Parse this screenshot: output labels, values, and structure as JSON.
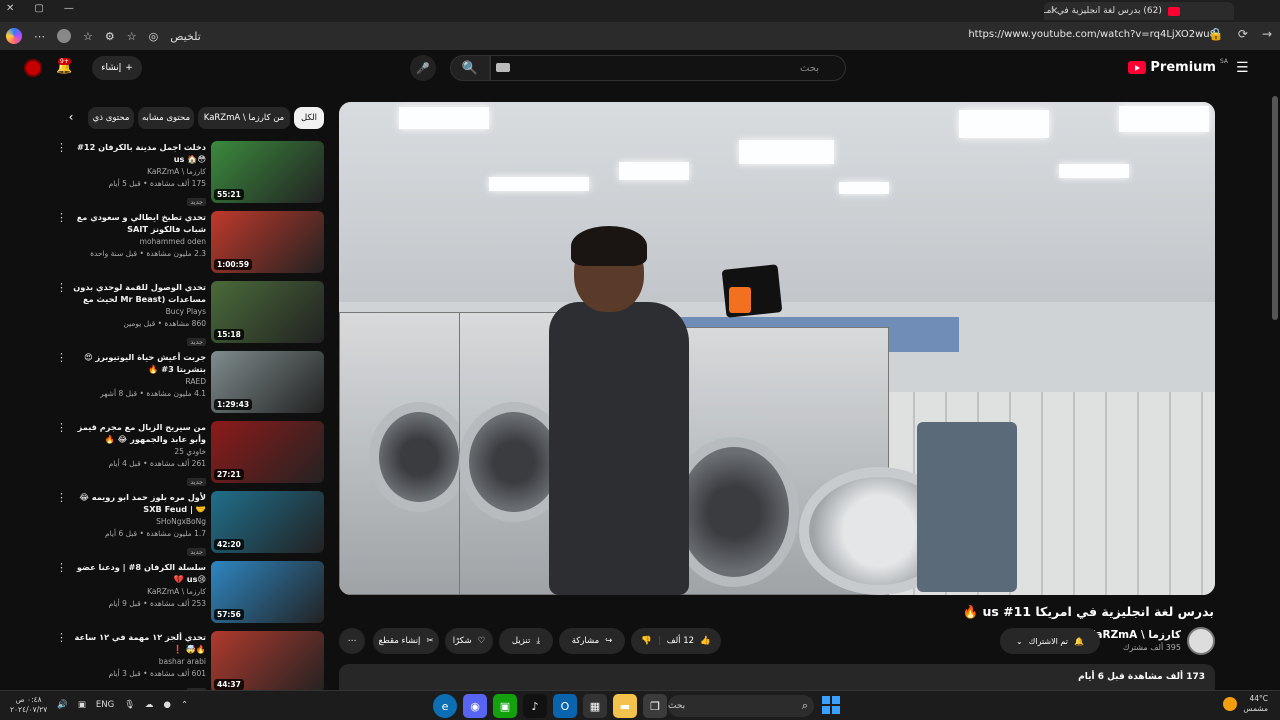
{
  "browser": {
    "tab_title": "(62) بدرس لغة انجليزية في امـ",
    "url": "https://www.youtube.com/watch?v=rq4LjXO2wu8",
    "summarize_label": "تلخيص"
  },
  "header": {
    "logo_text": "Premium",
    "logo_region": "SA",
    "search_placeholder": "بحث",
    "create_label": "إنشاء",
    "notification_count": "9+"
  },
  "video": {
    "title": "بدرس لغة انجليزية في امريكا us #11 🔥",
    "channel_name": "كارزما \\ KaRZmA",
    "subscribers": "395 ألف مشترك",
    "subscribe_label": "تم الاشتراك",
    "likes": "12 ألف",
    "share_label": "مشاركة",
    "download_label": "تنزيل",
    "thanks_label": "شكرًا",
    "clip_label": "إنشاء مقطع",
    "description_meta": "173 ألف مشاهدة  قبل 6 أيام"
  },
  "chips": [
    {
      "label": "الكل",
      "active": true
    },
    {
      "label": "من كارزما \\ KaRZmA",
      "active": false
    },
    {
      "label": "محتوى مشابه",
      "active": false
    },
    {
      "label": "محتوى ذي",
      "active": false
    }
  ],
  "recommendations": [
    {
      "title": "دخلت اجمل مدينة بالكرفان 12# 😳🏠 us",
      "channel": "كارزما \\ KaRZmA",
      "meta": "175 ألف مشاهدة • قبل 5 أيام",
      "badge": "جديد",
      "duration": "55:21",
      "thumb_color": "#3b8a3e"
    },
    {
      "title": "تحدي تطبخ ايطالي و سعودي مع شباب فالكونز SAIT",
      "channel": "mohammed oden",
      "meta": "2.3 مليون مشاهدة • قبل سنة واحدة",
      "badge": "",
      "duration": "1:00:59",
      "thumb_color": "#c0392b"
    },
    {
      "title": "تحدي الوصول للقمة لوحدي بدون مساعدات (Mr Beast لحيث مع شريه) 😨🇺🇸",
      "channel": "Bucy Plays",
      "meta": "860 مشاهدة • قبل يومين",
      "badge": "جديد",
      "duration": "15:18",
      "thumb_color": "#4a6b3a"
    },
    {
      "title": "جربت أعيش حياة اليوتيوبرز 😍 بتشريتا 3# 🔥",
      "channel": "RAED",
      "meta": "4.1 مليون مشاهدة • قبل 8 أشهر",
      "badge": "",
      "duration": "1:29:43",
      "thumb_color": "#7f8c8d"
    },
    {
      "title": "من سيربح الزبال مع مجرم قيمز وأبو عابد والجمهور 😂 🔥",
      "channel": "خاودي 25",
      "meta": "261 ألف مشاهدة • قبل 4 أيام",
      "badge": "جديد",
      "duration": "27:21",
      "thumb_color": "#8e1a1a"
    },
    {
      "title": "لأول مره بلوز حمد ابو رويمه 😂🤝 | SXB Feud",
      "channel": "SHoNgxBoNg",
      "meta": "1.7 مليون مشاهدة • قبل 6 أيام",
      "badge": "جديد",
      "duration": "42:20",
      "thumb_color": "#1f6f8b"
    },
    {
      "title": "سلسلة الكرفان 8# | ودعنا عضو 😢us 💔",
      "channel": "كارزما \\ KaRZmA",
      "meta": "253 ألف مشاهدة • قبل 9 أيام",
      "badge": "",
      "duration": "57:56",
      "thumb_color": "#2e86c1"
    },
    {
      "title": "تحدي ألجز ١٢ مهمة في ١٢ ساعة 🔥🤯 ❗",
      "channel": "bashar arabi",
      "meta": "601 ألف مشاهدة • قبل 3 أيام",
      "badge": "جديد",
      "duration": "44:37",
      "thumb_color": "#b03a2e"
    }
  ],
  "taskbar": {
    "search_label": "بحث",
    "language": "ENG",
    "time": "٠:٤٨ ص",
    "date": "٢٠٢٤/٠٧/٢٧",
    "temperature": "44°C",
    "weather": "مشمس"
  }
}
